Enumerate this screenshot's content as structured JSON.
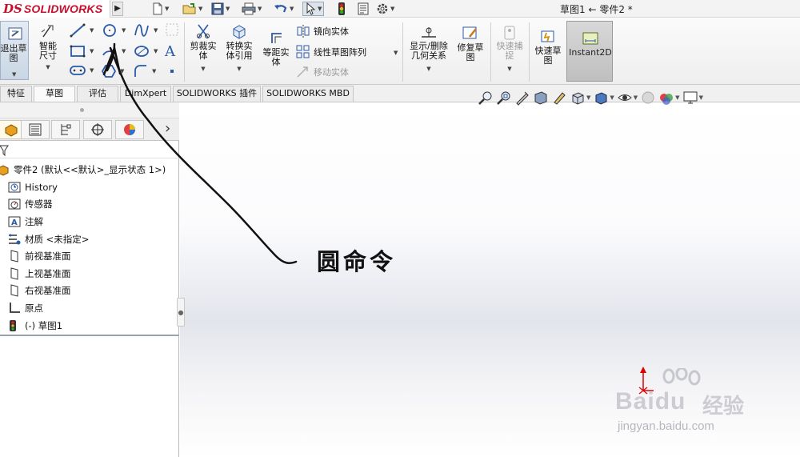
{
  "app": {
    "logo_prefix": "DS",
    "logo_name": "SOLIDWORKS",
    "document_title": "草图1 ← 零件2 *"
  },
  "quick_access": {
    "menu_arrow": "▶",
    "icons": [
      "new-document-icon",
      "open-icon",
      "save-icon",
      "print-icon",
      "undo-icon",
      "select-icon",
      "traffic-light-icon",
      "file-properties-icon",
      "options-gear-icon"
    ]
  },
  "ribbon": {
    "exit_sketch": "退出草图",
    "smart_dimension": "智能尺寸",
    "trim_entities": "剪裁实体",
    "convert_entities": "转换实体引用",
    "offset_entities": "等距实体",
    "mirror_entities": "镜向实体",
    "linear_pattern": "线性草图阵列",
    "move_entities": "移动实体",
    "display_relations": "显示/删除几何关系",
    "repair_sketch": "修复草图",
    "quick_snaps": "快速捕捉",
    "rapid_sketch": "快速草图",
    "instant2d": "Instant2D",
    "text_tool_glyph": "A"
  },
  "tabs": [
    {
      "label": "特征",
      "active": false
    },
    {
      "label": "草图",
      "active": true
    },
    {
      "label": "评估",
      "active": false
    },
    {
      "label": "DimXpert",
      "active": false
    },
    {
      "label": "SOLIDWORKS 插件",
      "active": false
    },
    {
      "label": "SOLIDWORKS MBD",
      "active": false
    }
  ],
  "panel": {
    "expand_arrow": "›",
    "tree": [
      {
        "label": "零件2  (默认<<默认>_显示状态 1>)",
        "icon": "part-icon"
      },
      {
        "label": "History",
        "icon": "history-icon"
      },
      {
        "label": "传感器",
        "icon": "sensor-icon"
      },
      {
        "label": "注解",
        "icon": "annotation-icon"
      },
      {
        "label": "材质 <未指定>",
        "icon": "material-icon"
      },
      {
        "label": "前视基准面",
        "icon": "plane-icon"
      },
      {
        "label": "上视基准面",
        "icon": "plane-icon"
      },
      {
        "label": "右视基准面",
        "icon": "plane-icon"
      },
      {
        "label": "原点",
        "icon": "origin-icon"
      },
      {
        "label": "(-) 草图1",
        "icon": "sketch-icon"
      }
    ]
  },
  "annotation": {
    "label": "圆命令"
  },
  "watermark": {
    "brand": "Bai",
    "brand2": "du",
    "chinese": "经验",
    "url": "jingyan.baidu.com"
  },
  "colors": {
    "brand_red": "#c8102e",
    "origin_red": "#e00000"
  }
}
